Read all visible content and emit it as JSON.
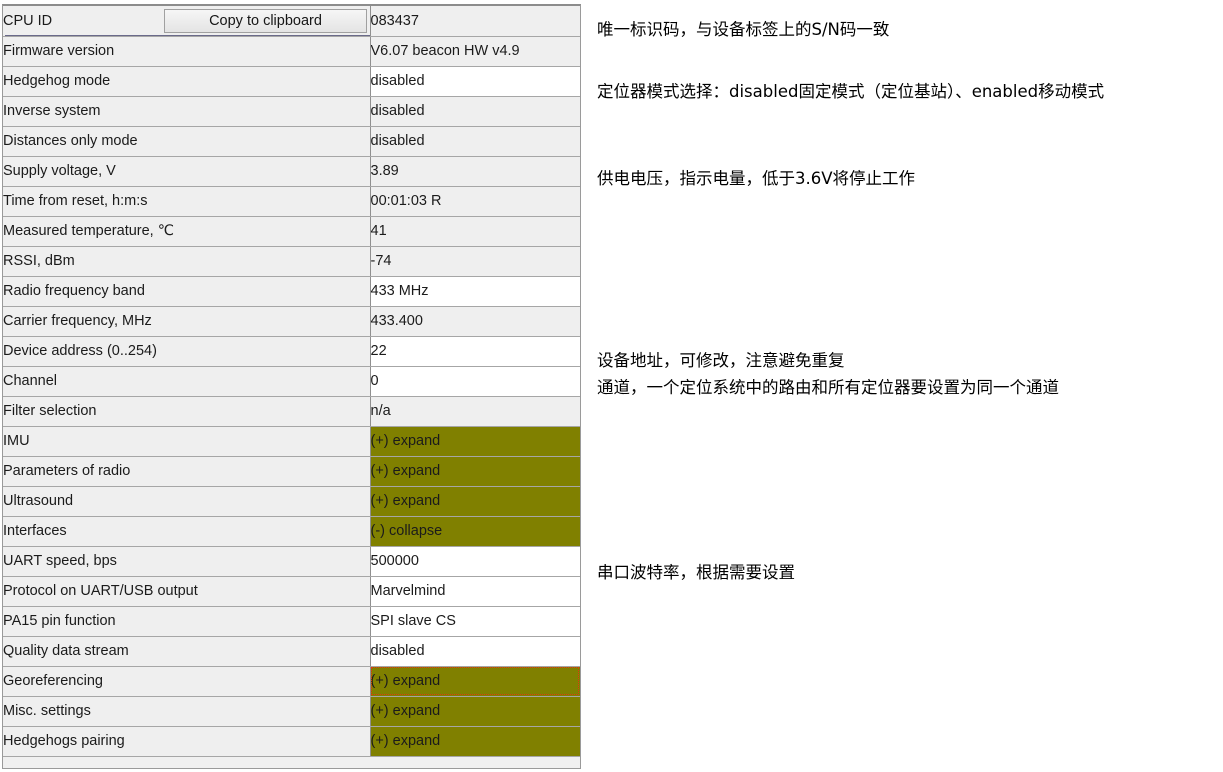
{
  "panel": {
    "name": "device-property-grid",
    "copy_button_label": "Copy to clipboard",
    "colors": {
      "expand_row": "#808000",
      "editable_row": "#ffffff",
      "readonly_row": "#efefef",
      "focus_outline": "#e03a10"
    },
    "rows": [
      {
        "label": "CPU ID",
        "value": "083437",
        "style": "readonly",
        "indent": false,
        "has_button": true,
        "focused": false
      },
      {
        "label": "Firmware version",
        "value": "V6.07 beacon HW v4.9",
        "style": "readonly",
        "indent": false,
        "has_button": false,
        "focused": false
      },
      {
        "label": "Hedgehog mode",
        "value": "disabled",
        "style": "editable",
        "indent": false,
        "has_button": false,
        "focused": false
      },
      {
        "label": "Inverse system",
        "value": "disabled",
        "style": "readonly",
        "indent": false,
        "has_button": false,
        "focused": false
      },
      {
        "label": "Distances only mode",
        "value": "disabled",
        "style": "readonly",
        "indent": false,
        "has_button": false,
        "focused": false
      },
      {
        "label": "Supply voltage, V",
        "value": "3.89",
        "style": "readonly",
        "indent": false,
        "has_button": false,
        "focused": false
      },
      {
        "label": "Time from reset, h:m:s",
        "value": "00:01:03  R",
        "style": "readonly",
        "indent": false,
        "has_button": false,
        "focused": false
      },
      {
        "label": "Measured temperature, ℃",
        "value": "41",
        "style": "readonly",
        "indent": false,
        "has_button": false,
        "focused": false
      },
      {
        "label": "RSSI, dBm",
        "value": "-74",
        "style": "readonly",
        "indent": false,
        "has_button": false,
        "focused": false
      },
      {
        "label": "Radio frequency band",
        "value": "433 MHz",
        "style": "editable",
        "indent": false,
        "has_button": false,
        "focused": false
      },
      {
        "label": "Carrier frequency, MHz",
        "value": "433.400",
        "style": "readonly",
        "indent": false,
        "has_button": false,
        "focused": false
      },
      {
        "label": "Device address (0..254)",
        "value": "22",
        "style": "editable",
        "indent": false,
        "has_button": false,
        "focused": false
      },
      {
        "label": "Channel",
        "value": "0",
        "style": "editable",
        "indent": false,
        "has_button": false,
        "focused": false
      },
      {
        "label": "Filter selection",
        "value": "n/a",
        "style": "readonly",
        "indent": false,
        "has_button": false,
        "focused": false
      },
      {
        "label": "IMU",
        "value": "(+) expand",
        "style": "expand",
        "indent": false,
        "has_button": false,
        "focused": false
      },
      {
        "label": "Parameters of radio",
        "value": "(+) expand",
        "style": "expand",
        "indent": false,
        "has_button": false,
        "focused": false
      },
      {
        "label": "Ultrasound",
        "value": "(+) expand",
        "style": "expand",
        "indent": false,
        "has_button": false,
        "focused": false
      },
      {
        "label": "Interfaces",
        "value": "(-) collapse",
        "style": "expand",
        "indent": false,
        "has_button": false,
        "focused": false
      },
      {
        "label": "UART speed, bps",
        "value": "500000",
        "style": "editable",
        "indent": true,
        "has_button": false,
        "focused": false
      },
      {
        "label": "Protocol on UART/USB output",
        "value": "Marvelmind",
        "style": "editable",
        "indent": true,
        "has_button": false,
        "focused": false
      },
      {
        "label": "PA15 pin function",
        "value": "SPI slave CS",
        "style": "editable",
        "indent": true,
        "has_button": false,
        "focused": false
      },
      {
        "label": "Quality data stream",
        "value": "disabled",
        "style": "editable",
        "indent": true,
        "has_button": false,
        "focused": false
      },
      {
        "label": "Georeferencing",
        "value": "(+) expand",
        "style": "expand",
        "indent": false,
        "has_button": false,
        "focused": true
      },
      {
        "label": "Misc. settings",
        "value": "(+) expand",
        "style": "expand",
        "indent": false,
        "has_button": false,
        "focused": false
      },
      {
        "label": "Hedgehogs pairing",
        "value": "(+) expand",
        "style": "expand",
        "indent": false,
        "has_button": false,
        "focused": false
      }
    ]
  },
  "annotations": {
    "cpu_id": "唯一标识码，与设备标签上的S/N码一致",
    "hedgehog_mode": "定位器模式选择：disabled固定模式（定位基站）、enabled移动模式",
    "supply_voltage": "供电电压，指示电量，低于3.6V将停止工作",
    "device_address_line1": "设备地址，可修改，注意避免重复",
    "device_address_line2": "通道，一个定位系统中的路由和所有定位器要设置为同一个通道",
    "uart_speed": "串口波特率，根据需要设置"
  }
}
